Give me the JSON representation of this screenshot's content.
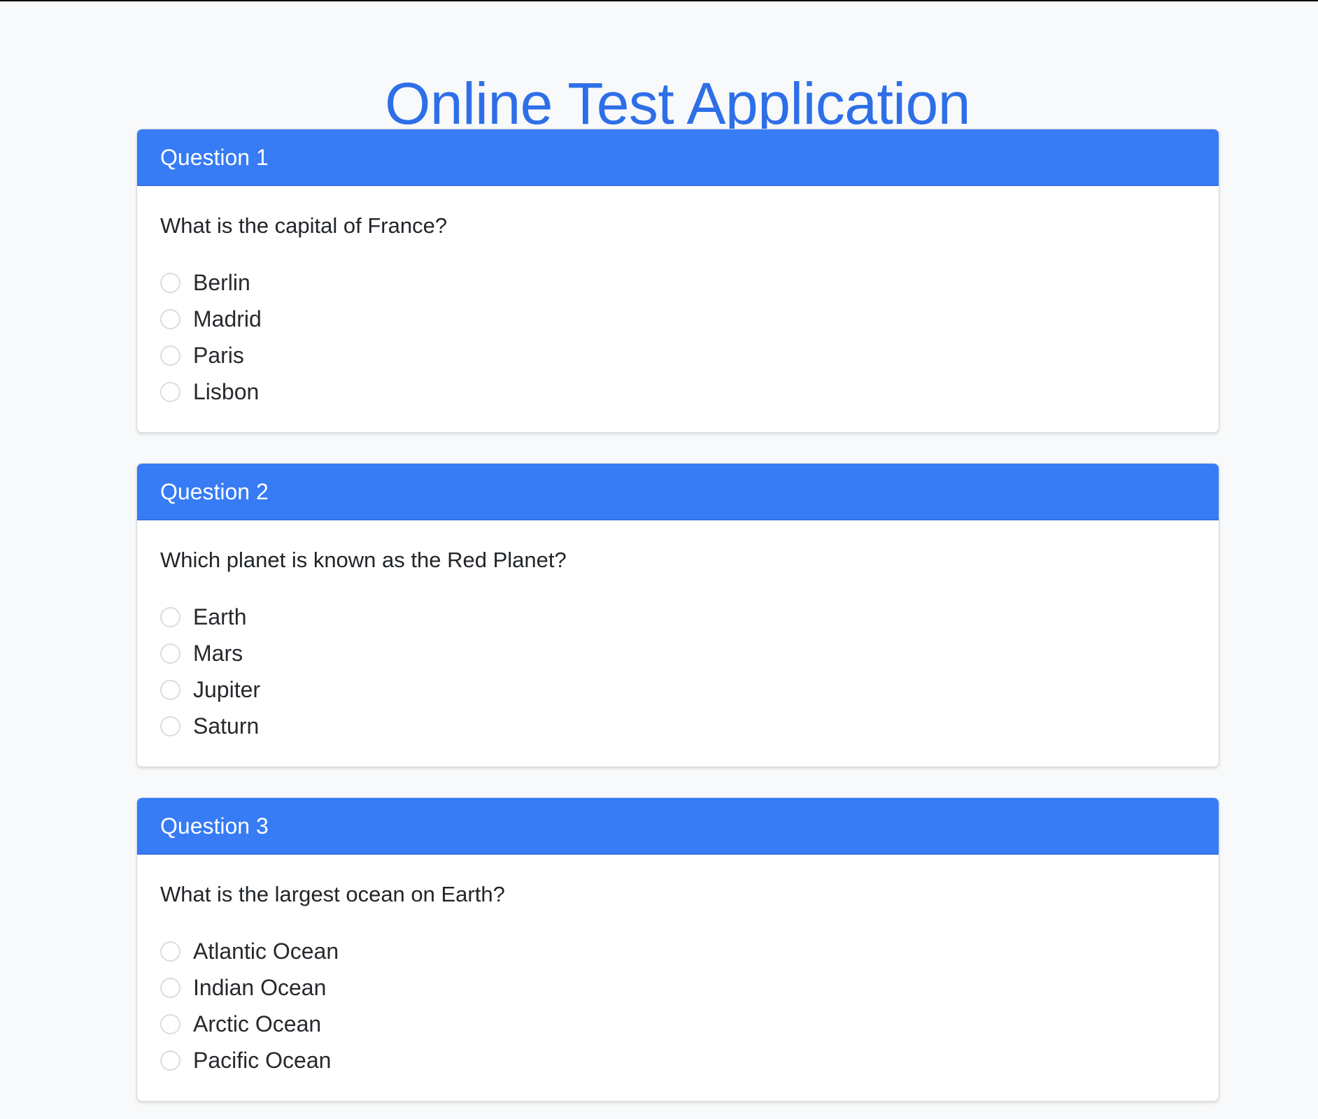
{
  "app": {
    "title": "Online Test Application",
    "accent_color": "#377bf5",
    "title_color": "#2e6fe8",
    "background_color": "#f8f9fa"
  },
  "questions": [
    {
      "header": "Question 1",
      "text": "What is the capital of France?",
      "options": [
        "Berlin",
        "Madrid",
        "Paris",
        "Lisbon"
      ]
    },
    {
      "header": "Question 2",
      "text": "Which planet is known as the Red Planet?",
      "options": [
        "Earth",
        "Mars",
        "Jupiter",
        "Saturn"
      ]
    },
    {
      "header": "Question 3",
      "text": "What is the largest ocean on Earth?",
      "options": [
        "Atlantic Ocean",
        "Indian Ocean",
        "Arctic Ocean",
        "Pacific Ocean"
      ]
    }
  ]
}
